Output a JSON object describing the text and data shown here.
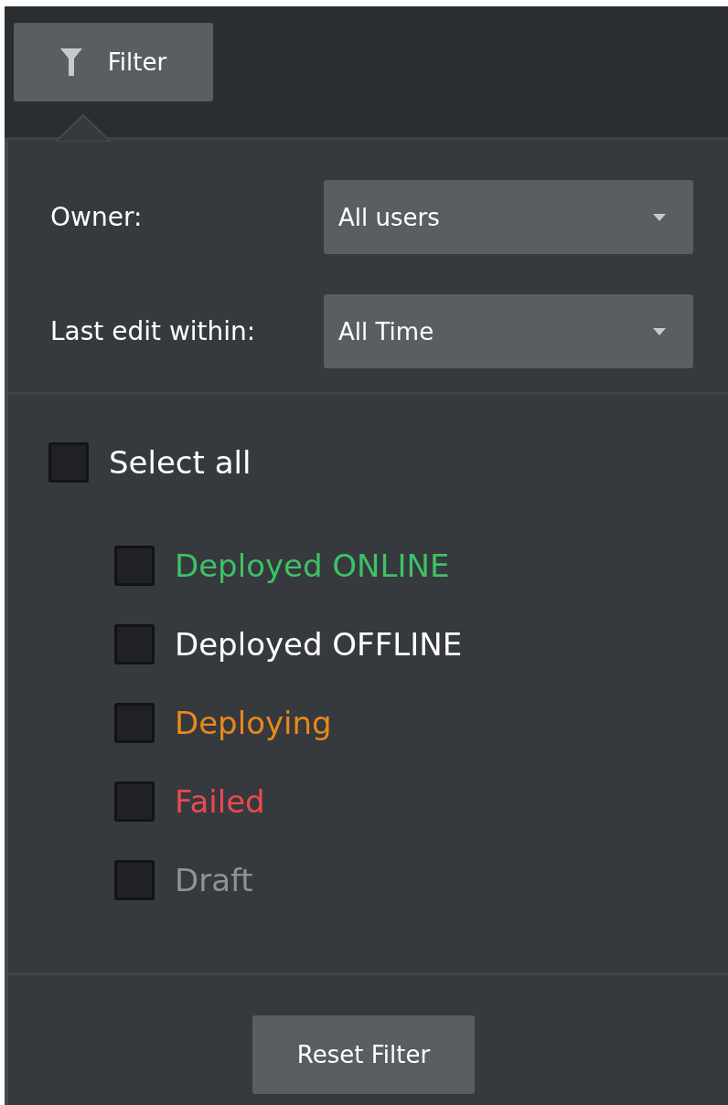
{
  "filter_button": {
    "label": "Filter"
  },
  "fields": [
    {
      "label": "Owner:",
      "value": "All users"
    },
    {
      "label": "Last edit within:",
      "value": "All Time"
    }
  ],
  "select_all": {
    "label": "Select all",
    "checked": false
  },
  "statuses": [
    {
      "label": "Deployed ONLINE",
      "checked": false,
      "color": "#3ec165"
    },
    {
      "label": "Deployed OFFLINE",
      "checked": false,
      "color": "#ffffff"
    },
    {
      "label": "Deploying",
      "checked": false,
      "color": "#e8891c"
    },
    {
      "label": "Failed",
      "checked": false,
      "color": "#e84a4f"
    },
    {
      "label": "Draft",
      "checked": false,
      "color": "#8e9398"
    }
  ],
  "reset_button": {
    "label": "Reset Filter"
  }
}
